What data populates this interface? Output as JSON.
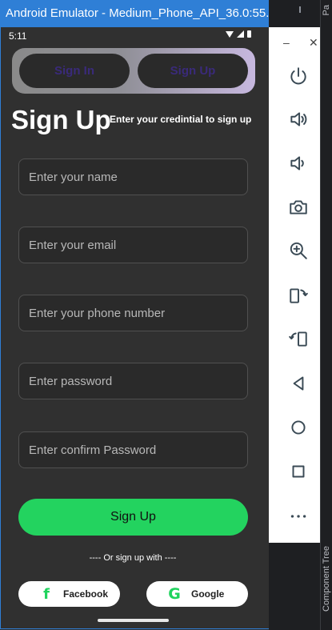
{
  "window": {
    "title": "Android Emulator - Medium_Phone_API_36.0:55..."
  },
  "ide": {
    "side_labels": [
      "Pa",
      "Component Tree"
    ]
  },
  "status_bar": {
    "time": "5:11"
  },
  "tabs": [
    {
      "label": "Sign In"
    },
    {
      "label": "Sign Up"
    }
  ],
  "header": {
    "title": "Sign Up",
    "subtitle": "Enter your credintial to sign up"
  },
  "form": {
    "fields": [
      {
        "placeholder": "Enter your name"
      },
      {
        "placeholder": "Enter your email"
      },
      {
        "placeholder": "Enter your phone number"
      },
      {
        "placeholder": "Enter password"
      },
      {
        "placeholder": "Enter confirm Password"
      }
    ],
    "submit_label": "Sign Up",
    "alt_text": "---- Or sign up with ----"
  },
  "social": {
    "facebook": {
      "label": "Facebook",
      "icon": "facebook-icon"
    },
    "google": {
      "label": "Google",
      "icon": "google-icon"
    }
  },
  "colors": {
    "accent": "#23d35f",
    "background": "#303030",
    "title_bar": "#2f7fd6"
  },
  "emulator_toolbar": {
    "icons": [
      "power-icon",
      "volume-up-icon",
      "volume-down-icon",
      "camera-icon",
      "zoom-in-icon",
      "rotate-left-icon",
      "rotate-right-icon",
      "back-icon",
      "home-icon",
      "overview-icon",
      "more-icon"
    ]
  }
}
